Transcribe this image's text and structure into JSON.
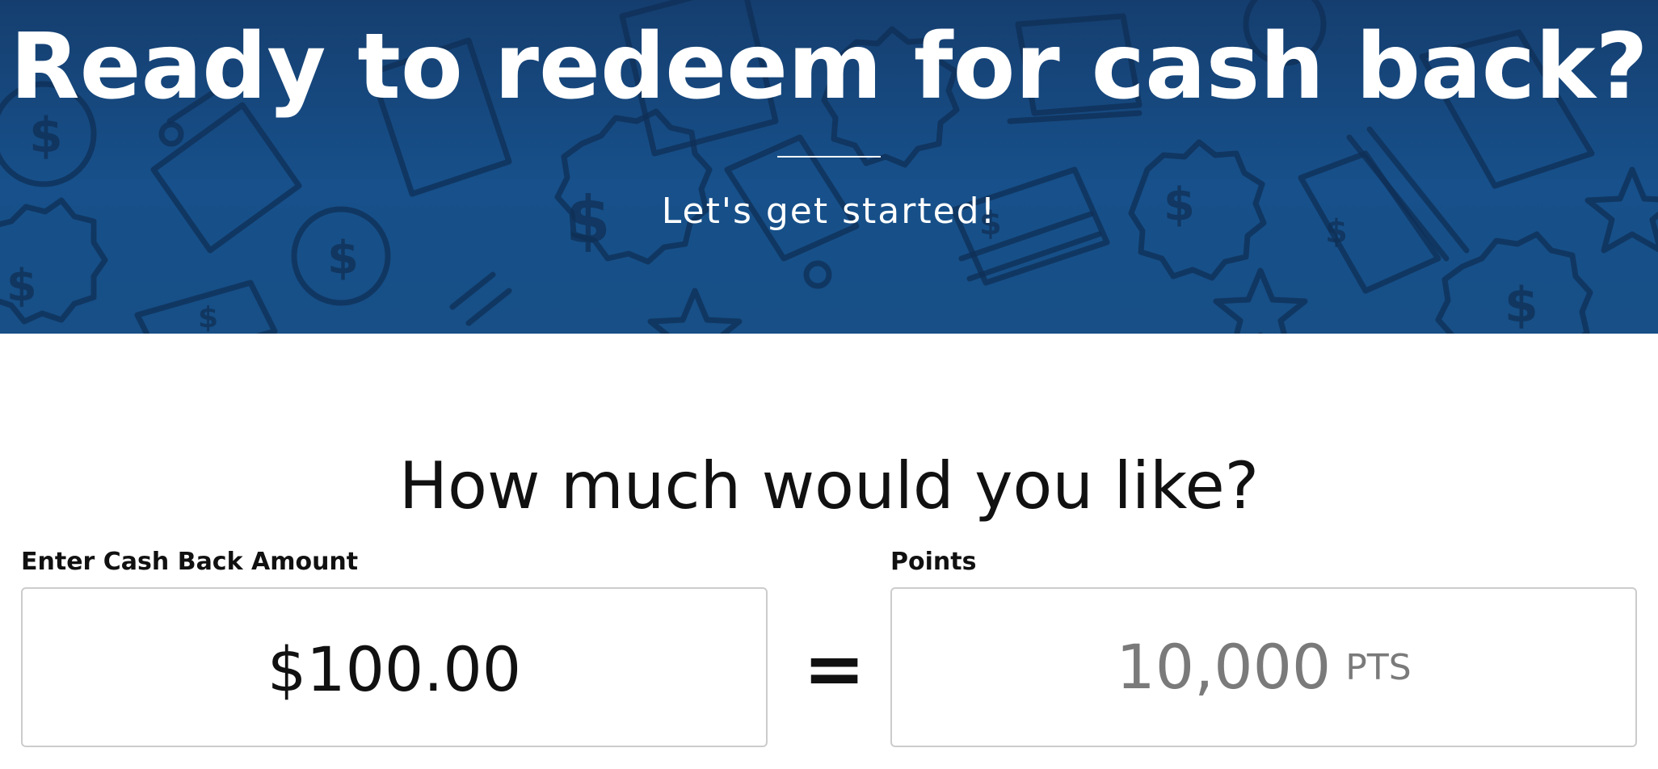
{
  "hero": {
    "title": "Ready to redeem for cash back?",
    "subtitle": "Let's get started!",
    "background_color": "#17508a"
  },
  "main": {
    "question": "How much would you like?",
    "cash_field": {
      "label": "Enter Cash Back Amount",
      "value": "$100.00"
    },
    "equals_sign": "=",
    "points_field": {
      "label": "Points",
      "value": "10,000",
      "unit": "PTS"
    }
  },
  "colors": {
    "text_primary": "#111111",
    "text_muted": "#7a7a7a",
    "border": "#cccccc",
    "hero_pattern": "#0f2f55"
  }
}
